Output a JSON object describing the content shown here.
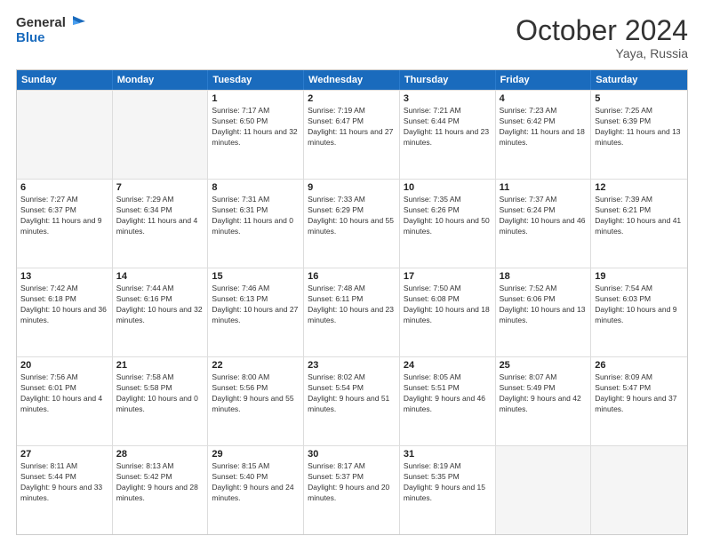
{
  "logo": {
    "line1": "General",
    "line2": "Blue"
  },
  "title": "October 2024",
  "subtitle": "Yaya, Russia",
  "header_days": [
    "Sunday",
    "Monday",
    "Tuesday",
    "Wednesday",
    "Thursday",
    "Friday",
    "Saturday"
  ],
  "weeks": [
    [
      {
        "date": "",
        "sunrise": "",
        "sunset": "",
        "daylight": "",
        "empty": true
      },
      {
        "date": "",
        "sunrise": "",
        "sunset": "",
        "daylight": "",
        "empty": true
      },
      {
        "date": "1",
        "sunrise": "Sunrise: 7:17 AM",
        "sunset": "Sunset: 6:50 PM",
        "daylight": "Daylight: 11 hours and 32 minutes.",
        "empty": false
      },
      {
        "date": "2",
        "sunrise": "Sunrise: 7:19 AM",
        "sunset": "Sunset: 6:47 PM",
        "daylight": "Daylight: 11 hours and 27 minutes.",
        "empty": false
      },
      {
        "date": "3",
        "sunrise": "Sunrise: 7:21 AM",
        "sunset": "Sunset: 6:44 PM",
        "daylight": "Daylight: 11 hours and 23 minutes.",
        "empty": false
      },
      {
        "date": "4",
        "sunrise": "Sunrise: 7:23 AM",
        "sunset": "Sunset: 6:42 PM",
        "daylight": "Daylight: 11 hours and 18 minutes.",
        "empty": false
      },
      {
        "date": "5",
        "sunrise": "Sunrise: 7:25 AM",
        "sunset": "Sunset: 6:39 PM",
        "daylight": "Daylight: 11 hours and 13 minutes.",
        "empty": false
      }
    ],
    [
      {
        "date": "6",
        "sunrise": "Sunrise: 7:27 AM",
        "sunset": "Sunset: 6:37 PM",
        "daylight": "Daylight: 11 hours and 9 minutes.",
        "empty": false
      },
      {
        "date": "7",
        "sunrise": "Sunrise: 7:29 AM",
        "sunset": "Sunset: 6:34 PM",
        "daylight": "Daylight: 11 hours and 4 minutes.",
        "empty": false
      },
      {
        "date": "8",
        "sunrise": "Sunrise: 7:31 AM",
        "sunset": "Sunset: 6:31 PM",
        "daylight": "Daylight: 11 hours and 0 minutes.",
        "empty": false
      },
      {
        "date": "9",
        "sunrise": "Sunrise: 7:33 AM",
        "sunset": "Sunset: 6:29 PM",
        "daylight": "Daylight: 10 hours and 55 minutes.",
        "empty": false
      },
      {
        "date": "10",
        "sunrise": "Sunrise: 7:35 AM",
        "sunset": "Sunset: 6:26 PM",
        "daylight": "Daylight: 10 hours and 50 minutes.",
        "empty": false
      },
      {
        "date": "11",
        "sunrise": "Sunrise: 7:37 AM",
        "sunset": "Sunset: 6:24 PM",
        "daylight": "Daylight: 10 hours and 46 minutes.",
        "empty": false
      },
      {
        "date": "12",
        "sunrise": "Sunrise: 7:39 AM",
        "sunset": "Sunset: 6:21 PM",
        "daylight": "Daylight: 10 hours and 41 minutes.",
        "empty": false
      }
    ],
    [
      {
        "date": "13",
        "sunrise": "Sunrise: 7:42 AM",
        "sunset": "Sunset: 6:18 PM",
        "daylight": "Daylight: 10 hours and 36 minutes.",
        "empty": false
      },
      {
        "date": "14",
        "sunrise": "Sunrise: 7:44 AM",
        "sunset": "Sunset: 6:16 PM",
        "daylight": "Daylight: 10 hours and 32 minutes.",
        "empty": false
      },
      {
        "date": "15",
        "sunrise": "Sunrise: 7:46 AM",
        "sunset": "Sunset: 6:13 PM",
        "daylight": "Daylight: 10 hours and 27 minutes.",
        "empty": false
      },
      {
        "date": "16",
        "sunrise": "Sunrise: 7:48 AM",
        "sunset": "Sunset: 6:11 PM",
        "daylight": "Daylight: 10 hours and 23 minutes.",
        "empty": false
      },
      {
        "date": "17",
        "sunrise": "Sunrise: 7:50 AM",
        "sunset": "Sunset: 6:08 PM",
        "daylight": "Daylight: 10 hours and 18 minutes.",
        "empty": false
      },
      {
        "date": "18",
        "sunrise": "Sunrise: 7:52 AM",
        "sunset": "Sunset: 6:06 PM",
        "daylight": "Daylight: 10 hours and 13 minutes.",
        "empty": false
      },
      {
        "date": "19",
        "sunrise": "Sunrise: 7:54 AM",
        "sunset": "Sunset: 6:03 PM",
        "daylight": "Daylight: 10 hours and 9 minutes.",
        "empty": false
      }
    ],
    [
      {
        "date": "20",
        "sunrise": "Sunrise: 7:56 AM",
        "sunset": "Sunset: 6:01 PM",
        "daylight": "Daylight: 10 hours and 4 minutes.",
        "empty": false
      },
      {
        "date": "21",
        "sunrise": "Sunrise: 7:58 AM",
        "sunset": "Sunset: 5:58 PM",
        "daylight": "Daylight: 10 hours and 0 minutes.",
        "empty": false
      },
      {
        "date": "22",
        "sunrise": "Sunrise: 8:00 AM",
        "sunset": "Sunset: 5:56 PM",
        "daylight": "Daylight: 9 hours and 55 minutes.",
        "empty": false
      },
      {
        "date": "23",
        "sunrise": "Sunrise: 8:02 AM",
        "sunset": "Sunset: 5:54 PM",
        "daylight": "Daylight: 9 hours and 51 minutes.",
        "empty": false
      },
      {
        "date": "24",
        "sunrise": "Sunrise: 8:05 AM",
        "sunset": "Sunset: 5:51 PM",
        "daylight": "Daylight: 9 hours and 46 minutes.",
        "empty": false
      },
      {
        "date": "25",
        "sunrise": "Sunrise: 8:07 AM",
        "sunset": "Sunset: 5:49 PM",
        "daylight": "Daylight: 9 hours and 42 minutes.",
        "empty": false
      },
      {
        "date": "26",
        "sunrise": "Sunrise: 8:09 AM",
        "sunset": "Sunset: 5:47 PM",
        "daylight": "Daylight: 9 hours and 37 minutes.",
        "empty": false
      }
    ],
    [
      {
        "date": "27",
        "sunrise": "Sunrise: 8:11 AM",
        "sunset": "Sunset: 5:44 PM",
        "daylight": "Daylight: 9 hours and 33 minutes.",
        "empty": false
      },
      {
        "date": "28",
        "sunrise": "Sunrise: 8:13 AM",
        "sunset": "Sunset: 5:42 PM",
        "daylight": "Daylight: 9 hours and 28 minutes.",
        "empty": false
      },
      {
        "date": "29",
        "sunrise": "Sunrise: 8:15 AM",
        "sunset": "Sunset: 5:40 PM",
        "daylight": "Daylight: 9 hours and 24 minutes.",
        "empty": false
      },
      {
        "date": "30",
        "sunrise": "Sunrise: 8:17 AM",
        "sunset": "Sunset: 5:37 PM",
        "daylight": "Daylight: 9 hours and 20 minutes.",
        "empty": false
      },
      {
        "date": "31",
        "sunrise": "Sunrise: 8:19 AM",
        "sunset": "Sunset: 5:35 PM",
        "daylight": "Daylight: 9 hours and 15 minutes.",
        "empty": false
      },
      {
        "date": "",
        "sunrise": "",
        "sunset": "",
        "daylight": "",
        "empty": true
      },
      {
        "date": "",
        "sunrise": "",
        "sunset": "",
        "daylight": "",
        "empty": true
      }
    ]
  ]
}
